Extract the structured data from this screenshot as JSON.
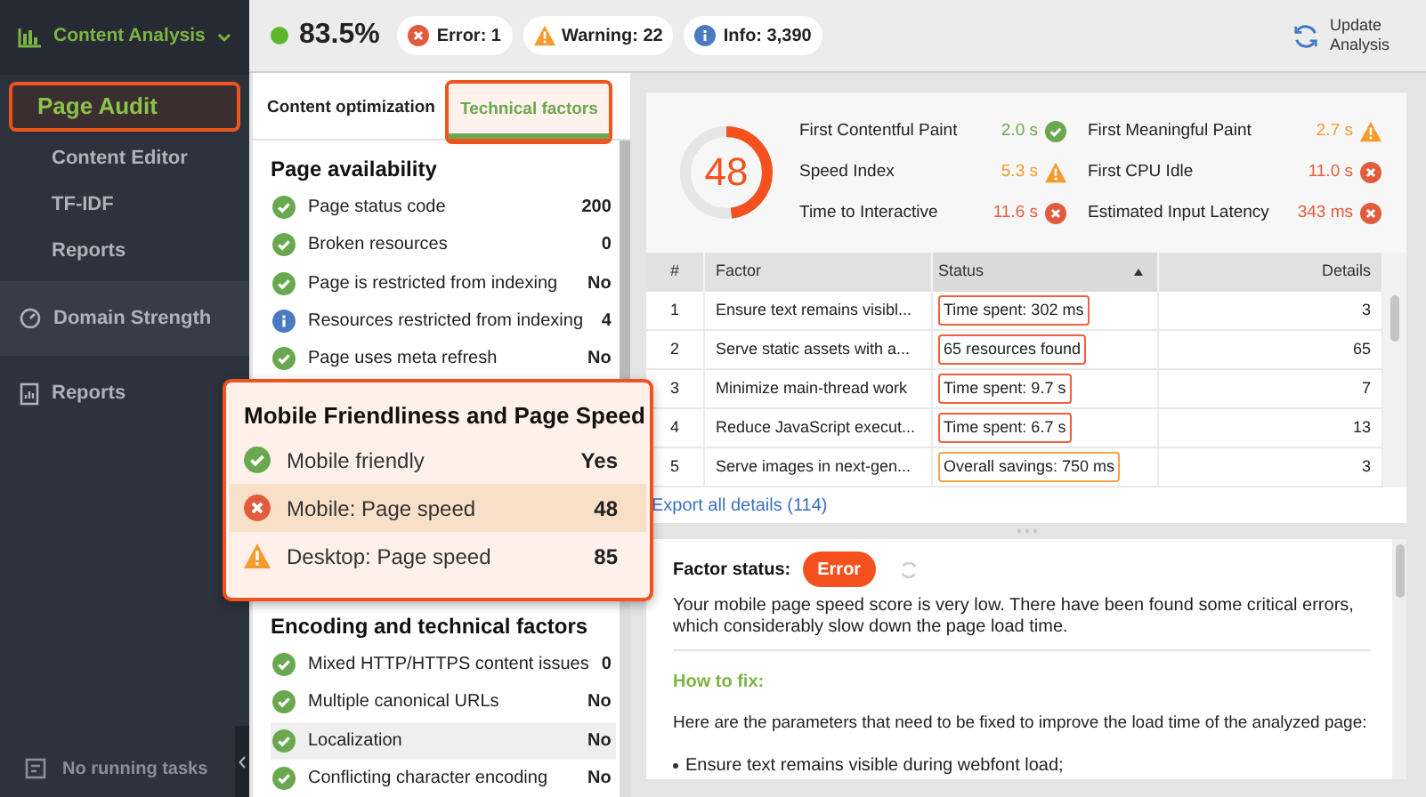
{
  "sidebar": {
    "header": {
      "label": "Content Analysis",
      "expanded": true
    },
    "items": [
      {
        "label": "Page Audit",
        "selected": true
      },
      {
        "label": "Content Editor",
        "selected": false
      },
      {
        "label": "TF-IDF",
        "selected": false
      },
      {
        "label": "Reports",
        "selected": false
      }
    ],
    "sections": [
      {
        "kind": "gauge",
        "label": "Domain Strength"
      },
      {
        "kind": "report",
        "label": "Reports"
      }
    ],
    "footer": "No running tasks"
  },
  "topbar": {
    "score": "83.5%",
    "badges": [
      {
        "kind": "error",
        "label": "Error: 1"
      },
      {
        "kind": "warning",
        "label": "Warning: 22"
      },
      {
        "kind": "info",
        "label": "Info: 3,390"
      }
    ],
    "update_button": "Update Analysis"
  },
  "left_panel": {
    "tabs": [
      {
        "label": "Content optimization",
        "selected": false
      },
      {
        "label": "Technical factors",
        "selected": true
      }
    ],
    "sections": [
      {
        "title": "Page availability",
        "items": [
          {
            "kind": "ok",
            "label": "Page status code",
            "value": "200",
            "selected": false
          },
          {
            "kind": "ok",
            "label": "Broken resources",
            "value": "0",
            "selected": false
          },
          {
            "kind": "ok",
            "label": "Page is restricted from indexing",
            "value": "No",
            "selected": false
          },
          {
            "kind": "info",
            "label": "Resources restricted from indexing",
            "value": "4",
            "selected": false
          },
          {
            "kind": "ok",
            "label": "Page uses meta refresh",
            "value": "No",
            "selected": false
          }
        ]
      },
      {
        "title": "Encoding and technical factors",
        "items": [
          {
            "kind": "ok",
            "label": "Mixed HTTP/HTTPS content issues",
            "value": "0",
            "selected": false
          },
          {
            "kind": "ok",
            "label": "Multiple canonical URLs",
            "value": "No",
            "selected": false
          },
          {
            "kind": "ok",
            "label": "Localization",
            "value": "No",
            "selected": true
          },
          {
            "kind": "ok",
            "label": "Conflicting character encoding",
            "value": "No",
            "selected": false
          }
        ]
      }
    ]
  },
  "popup": {
    "title": "Mobile Friendliness and Page Speed",
    "items": [
      {
        "kind": "ok",
        "label": "Mobile friendly",
        "value": "Yes",
        "selected": false
      },
      {
        "kind": "error",
        "label": "Mobile: Page speed",
        "value": "48",
        "selected": true
      },
      {
        "kind": "warning",
        "label": "Desktop: Page speed",
        "value": "85",
        "selected": false
      }
    ]
  },
  "right_panel": {
    "gauge": {
      "score": "48",
      "level": 0.48
    },
    "metrics": [
      {
        "label": "First Contentful Paint",
        "value": "2.0 s",
        "kind": "ok"
      },
      {
        "label": "First Meaningful Paint",
        "value": "2.7 s",
        "kind": "warning"
      },
      {
        "label": "Speed Index",
        "value": "5.3 s",
        "kind": "warning"
      },
      {
        "label": "First CPU Idle",
        "value": "11.0 s",
        "kind": "error"
      },
      {
        "label": "Time to Interactive",
        "value": "11.6 s",
        "kind": "error"
      },
      {
        "label": "Estimated Input Latency",
        "value": "343 ms",
        "kind": "error"
      }
    ],
    "table": {
      "columns": [
        {
          "label": "#",
          "sorted": false
        },
        {
          "label": "Factor",
          "sorted": false
        },
        {
          "label": "Status",
          "sorted": true
        },
        {
          "label": "Details",
          "sorted": false
        }
      ],
      "rows": [
        {
          "num": "1",
          "factor": "Ensure text remains visibl...",
          "status_text": "Time spent: 302 ms",
          "kind": "error",
          "details": "3"
        },
        {
          "num": "2",
          "factor": "Serve static assets with a...",
          "status_text": "65 resources found",
          "kind": "error",
          "details": "65"
        },
        {
          "num": "3",
          "factor": "Minimize main-thread work",
          "status_text": "Time spent: 9.7 s",
          "kind": "error",
          "details": "7"
        },
        {
          "num": "4",
          "factor": "Reduce JavaScript execut...",
          "status_text": "Time spent: 6.7 s",
          "kind": "error",
          "details": "13"
        },
        {
          "num": "5",
          "factor": "Serve images in next-gen...",
          "status_text": "Overall savings: 750 ms",
          "kind": "warning",
          "details": "3"
        }
      ]
    },
    "export_link": "Export all details (114)",
    "factor_status": {
      "label": "Factor status:",
      "badge": {
        "label": "Error",
        "kind": "error"
      },
      "description": "Your mobile page speed score is very low. There have been found some critical errors, which considerably slow down the page load time.",
      "how_to_fix_title": "How to fix:",
      "how_to_fix_text": "Here are the parameters that need to be fixed to improve the load time of the analyzed page:",
      "bullets": [
        "Ensure text remains visible during webfont load;"
      ]
    }
  }
}
